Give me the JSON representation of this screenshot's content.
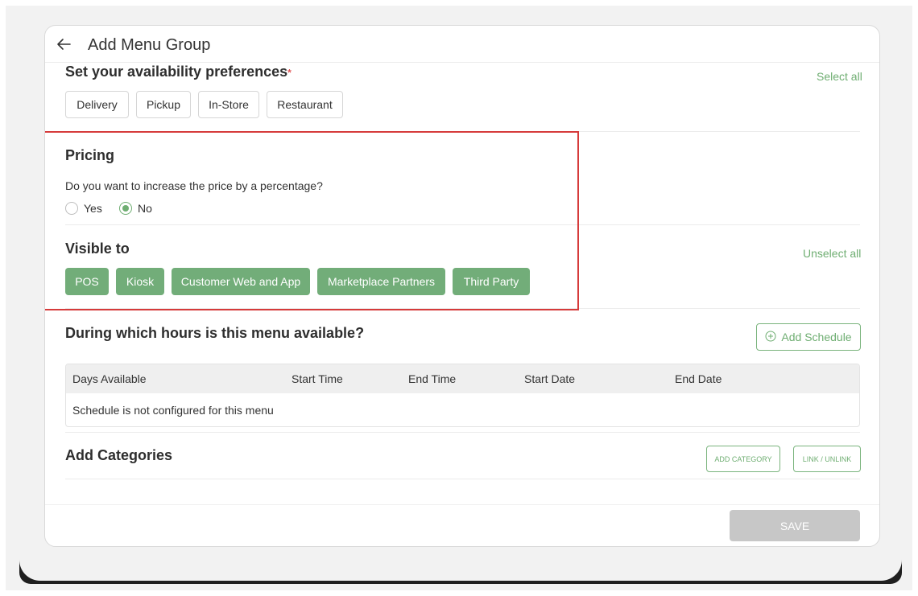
{
  "header": {
    "title": "Add Menu Group"
  },
  "availability": {
    "title": "Set your availability preferences",
    "required_mark": "*",
    "select_all": "Select all",
    "options": [
      "Delivery",
      "Pickup",
      "In-Store",
      "Restaurant"
    ]
  },
  "pricing": {
    "title": "Pricing",
    "question": "Do you want to increase the price by a percentage?",
    "options": [
      "Yes",
      "No"
    ],
    "selected": "No"
  },
  "visible_to": {
    "title": "Visible to",
    "unselect_all": "Unselect all",
    "options": [
      "POS",
      "Kiosk",
      "Customer Web and App",
      "Marketplace Partners",
      "Third Party"
    ]
  },
  "schedule": {
    "title": "During which hours is this menu available?",
    "add_label": "Add Schedule",
    "columns": [
      "Days Available",
      "Start Time",
      "End Time",
      "Start Date",
      "End Date"
    ],
    "empty_message": "Schedule is not configured for this menu"
  },
  "categories": {
    "title": "Add Categories",
    "add_label": "ADD CATEGORY",
    "link_label": "LINK / UNLINK"
  },
  "footer": {
    "save_label": "SAVE"
  },
  "colors": {
    "accent": "#72ad79",
    "highlight": "#d63b3b",
    "disabled": "#c7c7c7"
  }
}
